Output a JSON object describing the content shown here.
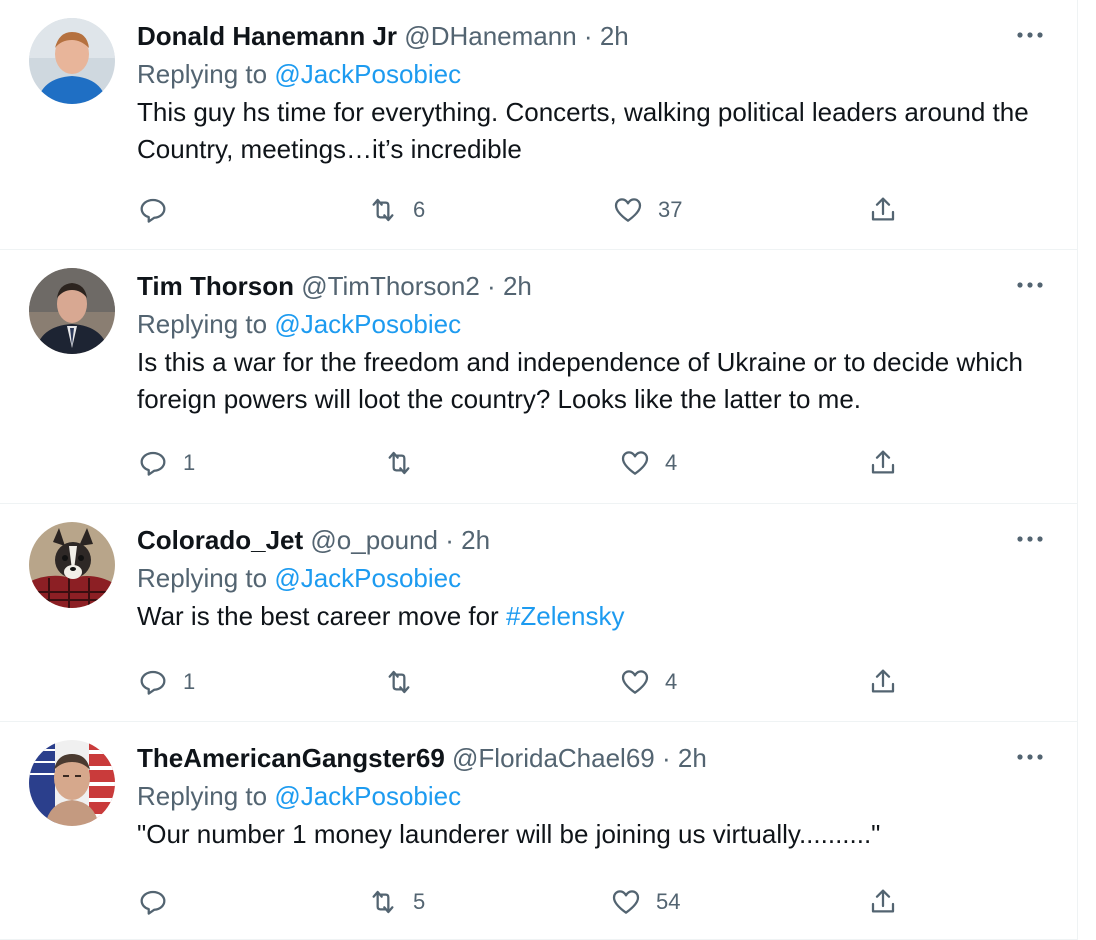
{
  "tweets": [
    {
      "name": "Donald Hanemann Jr",
      "handle": "@DHanemann",
      "separator": "·",
      "time": "2h",
      "replying_prefix": "Replying to",
      "replying_to": "@JackPosobiec",
      "text": "This guy hs time for everything. Concerts, walking political leaders around the Country, meetings…it’s incredible",
      "replies": "",
      "retweets": "6",
      "likes": "37"
    },
    {
      "name": "Tim Thorson",
      "handle": "@TimThorson2",
      "separator": "·",
      "time": "2h",
      "replying_prefix": "Replying to",
      "replying_to": "@JackPosobiec",
      "text": "Is this a war for the freedom and independence of Ukraine or to decide which foreign powers will loot the country? Looks like the latter to me.",
      "replies": "1",
      "retweets": "",
      "likes": "4"
    },
    {
      "name": "Colorado_Jet",
      "handle": "@o_pound",
      "separator": "·",
      "time": "2h",
      "replying_prefix": "Replying to",
      "replying_to": "@JackPosobiec",
      "text": "War is the best career move for ",
      "hashtag": "#Zelensky",
      "replies": "1",
      "retweets": "",
      "likes": "4"
    },
    {
      "name": "TheAmericanGangster69",
      "handle": "@FloridaChael69",
      "separator": "·",
      "time": "2h",
      "replying_prefix": "Replying to",
      "replying_to": "@JackPosobiec",
      "text": "\"Our number 1 money launderer will be joining us virtually..........\"",
      "replies": "",
      "retweets": "5",
      "likes": "54"
    }
  ],
  "icons": {
    "more": "more-dots-icon",
    "reply": "reply-icon",
    "retweet": "retweet-icon",
    "like": "heart-icon",
    "share": "share-icon"
  },
  "colors": {
    "link": "#1d9bf0",
    "secondary_text": "#536471",
    "primary_text": "#0f1419",
    "divider": "#eff3f4"
  }
}
